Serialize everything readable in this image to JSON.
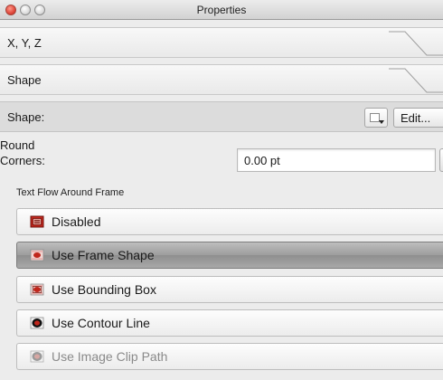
{
  "window": {
    "title": "Properties"
  },
  "sections": {
    "xyz": "X, Y, Z",
    "shape": "Shape"
  },
  "shape_row": {
    "label": "Shape:",
    "edit_label": "Edit..."
  },
  "round_corners": {
    "label_line1": "Round",
    "label_line2": "Corners:",
    "value": "0.00 pt"
  },
  "text_flow": {
    "group_label": "Text Flow Around Frame",
    "options": [
      {
        "label": "Disabled",
        "icon": "frame-disabled-icon",
        "selected": false,
        "enabled": true
      },
      {
        "label": "Use Frame Shape",
        "icon": "frame-shape-icon",
        "selected": true,
        "enabled": true
      },
      {
        "label": "Use Bounding Box",
        "icon": "bounding-box-icon",
        "selected": false,
        "enabled": true
      },
      {
        "label": "Use Contour Line",
        "icon": "contour-line-icon",
        "selected": false,
        "enabled": true
      },
      {
        "label": "Use Image Clip Path",
        "icon": "image-clip-path-icon",
        "selected": false,
        "enabled": false
      }
    ]
  },
  "colors": {
    "accent_red": "#c0261c"
  }
}
